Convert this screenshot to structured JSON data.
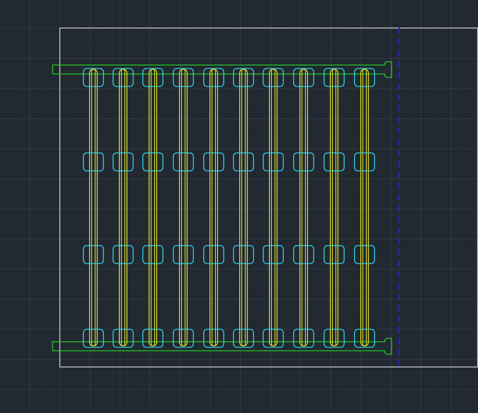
{
  "viewport": {
    "title": "",
    "background_color": "#212830"
  },
  "layers": {
    "grid": {
      "major_color": "#2f3945",
      "minor_color": "#262e38"
    },
    "sheet_border": {
      "color": "#d8d8d8"
    },
    "boundary_line": {
      "color": "#2222cc",
      "linetype": "dashed"
    },
    "manifold_pipes": {
      "color": "#22cc22"
    },
    "support_pads": {
      "color": "#2fd6e6"
    },
    "hairpin_tubes": {
      "color": "#e6e622"
    }
  },
  "drawing": {
    "tube_count": 10,
    "pad_rows": 4,
    "manifold_count": 2
  }
}
